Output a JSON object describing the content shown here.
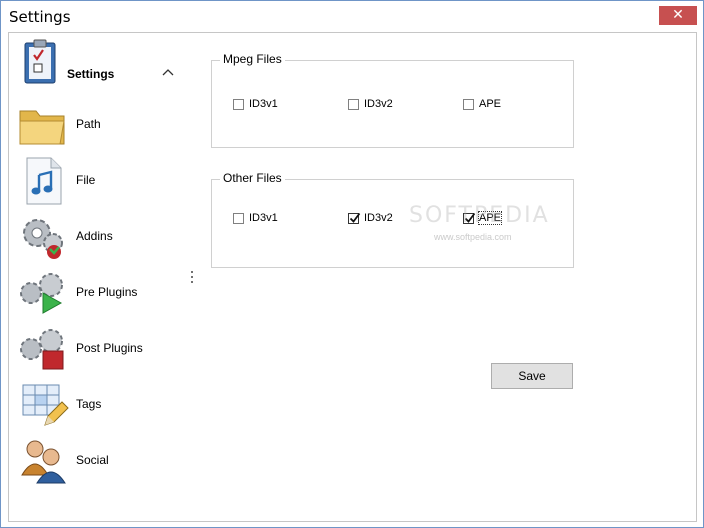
{
  "window": {
    "title": "Settings",
    "close_glyph": "✕"
  },
  "nav": {
    "header": {
      "label": "Settings",
      "icon": "clipboard-checklist-icon"
    },
    "items": [
      {
        "label": "Path",
        "icon": "folder-icon"
      },
      {
        "label": "File",
        "icon": "music-file-icon"
      },
      {
        "label": "Addins",
        "icon": "gears-addins-icon"
      },
      {
        "label": "Pre Plugins",
        "icon": "gears-play-icon"
      },
      {
        "label": "Post Plugins",
        "icon": "gears-stop-icon"
      },
      {
        "label": "Tags",
        "icon": "grid-pencil-icon"
      },
      {
        "label": "Social",
        "icon": "users-icon"
      }
    ]
  },
  "groups": {
    "mpeg": {
      "title": "Mpeg Files",
      "options": [
        {
          "label": "ID3v1",
          "checked": false
        },
        {
          "label": "ID3v2",
          "checked": false
        },
        {
          "label": "APE",
          "checked": false
        }
      ]
    },
    "other": {
      "title": "Other Files",
      "options": [
        {
          "label": "ID3v1",
          "checked": false
        },
        {
          "label": "ID3v2",
          "checked": true
        },
        {
          "label": "APE",
          "checked": true
        }
      ]
    }
  },
  "actions": {
    "save_label": "Save"
  },
  "watermark": {
    "text": "SOFTPEDIA",
    "url": "www.softpedia.com"
  },
  "colors": {
    "close_button": "#c75050",
    "window_border": "#6f95c7",
    "button_bg": "#e1e1e1"
  }
}
